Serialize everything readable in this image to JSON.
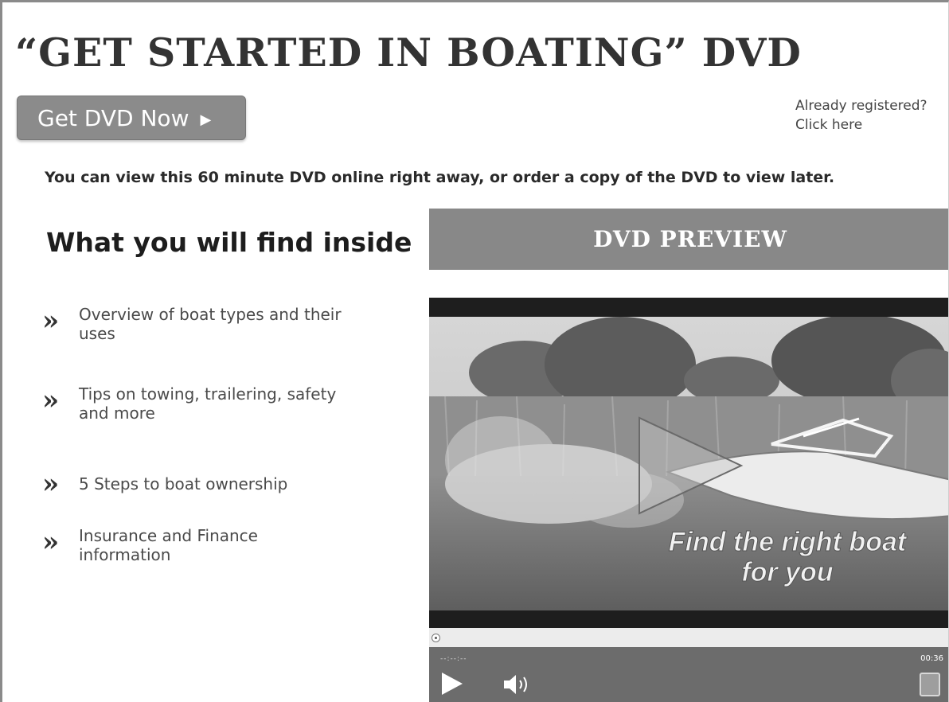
{
  "header": {
    "title": "“GET STARTED IN BOATING” DVD"
  },
  "cta": {
    "get_dvd_label": "Get DVD Now",
    "arrow": "▶"
  },
  "login": {
    "line1": "Already registered?",
    "line2": "Click here"
  },
  "intro_text": "You can view this 60 minute DVD online right away, or order a copy of the DVD to view later.",
  "features": {
    "heading": "What you will find inside",
    "bullet_glyph": "»",
    "items": [
      {
        "line1": "Overview of boat types and their",
        "line2": "uses"
      },
      {
        "line1": "Tips on towing, trailering, safety",
        "line2": "and more"
      },
      {
        "line1": "5 Steps to boat ownership",
        "line2": ""
      },
      {
        "line1": "Insurance and Finance",
        "line2": "information"
      }
    ]
  },
  "preview": {
    "header_label": "DVD PREVIEW",
    "caption_line1": "Find the right boat",
    "caption_line2": "for you",
    "time_elapsed": "--:--:--",
    "time_total": "00:36"
  }
}
